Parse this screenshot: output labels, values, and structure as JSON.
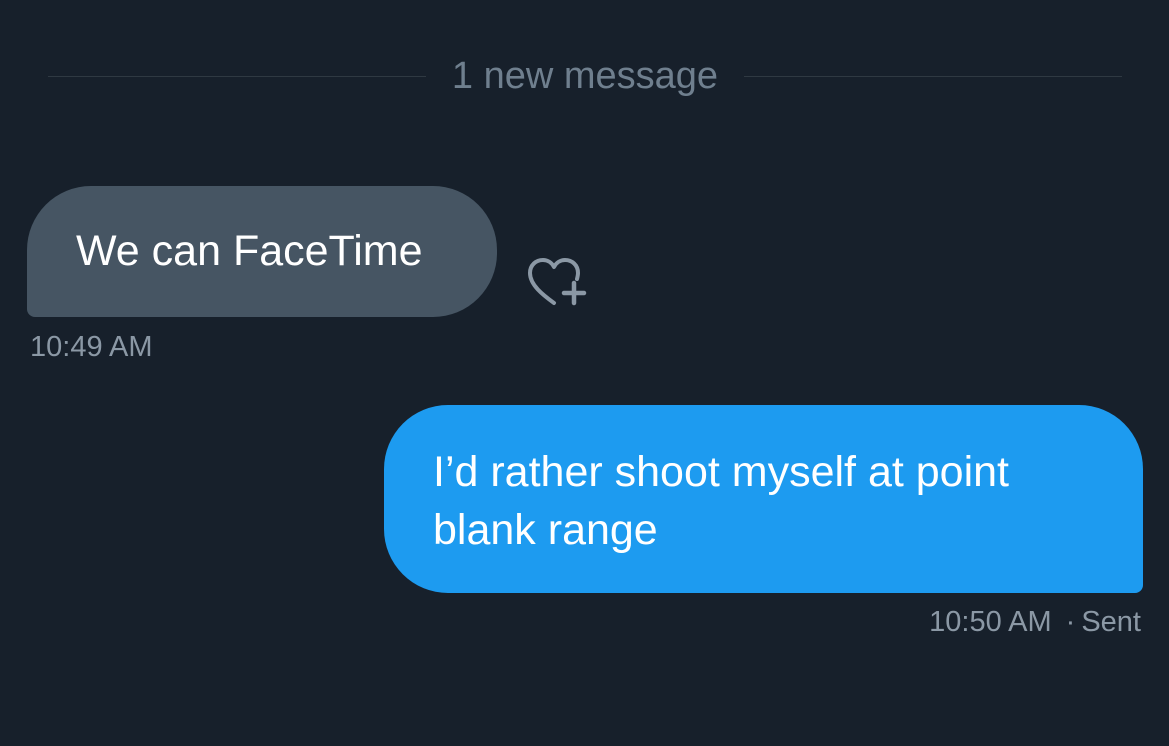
{
  "divider": {
    "label": "1 new message"
  },
  "messages": [
    {
      "direction": "received",
      "text": "We can FaceTime",
      "time": "10:49 AM",
      "reaction_icon": "heart-plus-icon"
    },
    {
      "direction": "sent",
      "text": "I’d rather shoot myself at point blank range",
      "time": "10:50 AM",
      "status": "Sent"
    }
  ],
  "colors": {
    "background": "#17202b",
    "received_bubble": "#465563",
    "sent_bubble": "#1d9bf0",
    "muted_text": "#8b98a5",
    "divider_text": "#6f7f8e"
  }
}
